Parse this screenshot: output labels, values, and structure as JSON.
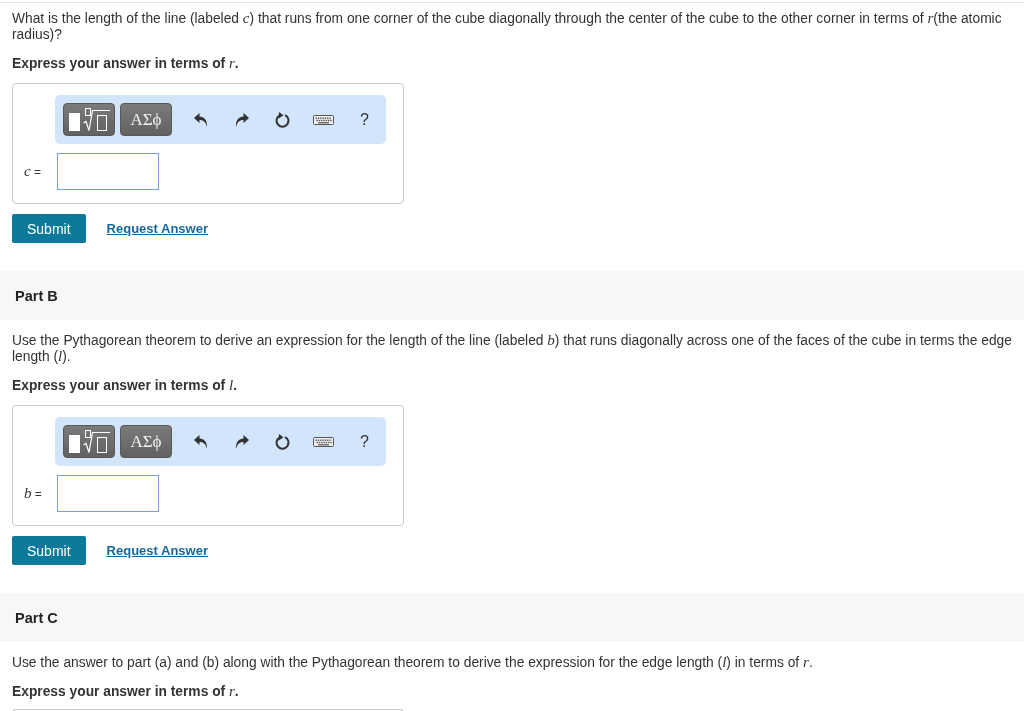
{
  "parts": [
    {
      "question": "What is the length of the line (labeled *c*) that runs from one corner of the cube diagonally through the center of the cube to the other corner in terms of *r*(the atomic radius)?",
      "instruction": "Express your answer in terms of *r*.",
      "answer": {
        "toolbar": {
          "symbols": "ΑΣϕ",
          "help": "?"
        },
        "label": "*c* ="
      },
      "actions": {
        "submit": "Submit",
        "request": "Request Answer"
      }
    },
    {
      "heading": "Part B",
      "question": "Use the Pythagorean theorem to derive an expression for the length of the line (labeled *b*) that runs diagonally across one of the faces of the cube in terms the edge length (*l*).",
      "instruction": "Express your answer in terms of *l*.",
      "answer": {
        "toolbar": {
          "symbols": "ΑΣϕ",
          "help": "?"
        },
        "label": "*b* ="
      },
      "actions": {
        "submit": "Submit",
        "request": "Request Answer"
      }
    },
    {
      "heading": "Part C",
      "question": "Use the answer to part (a) and (b) along with the Pythagorean theorem to derive the expression for the edge length (*l*) in terms of *r*.",
      "instruction": "Express your answer in terms of *r*."
    }
  ]
}
